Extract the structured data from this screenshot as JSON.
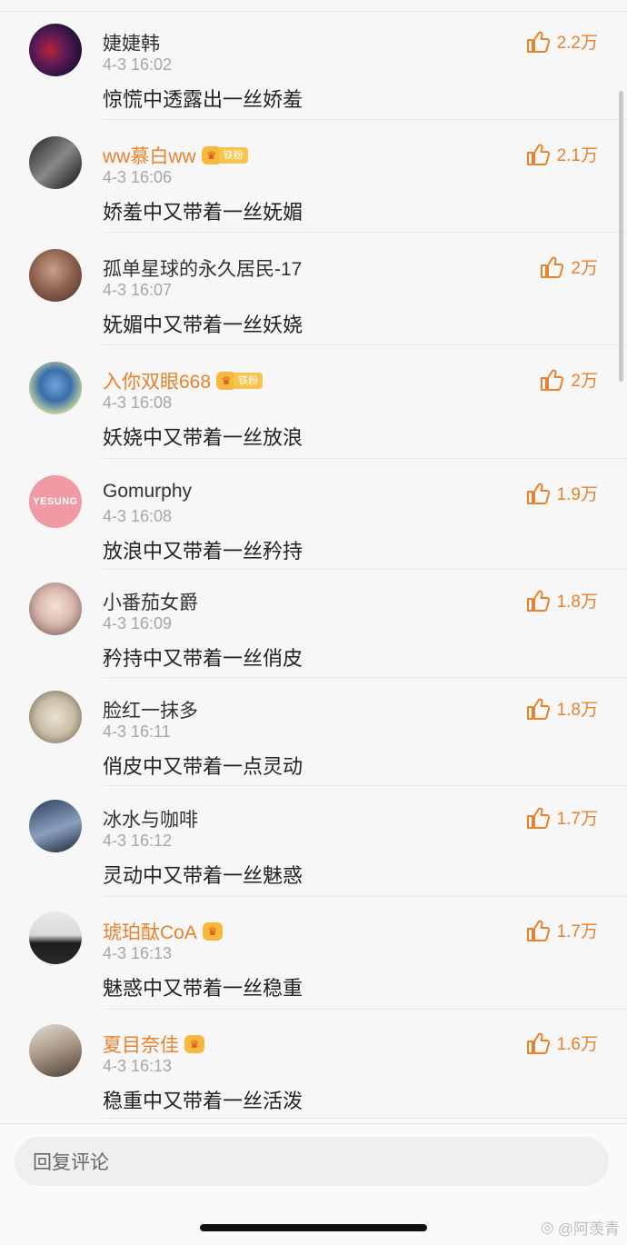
{
  "comments": [
    {
      "name": "婕婕韩",
      "vip": false,
      "badge": "",
      "fan_label": "",
      "time": "4-3 16:02",
      "text": "惊慌中透露出一丝娇羞",
      "likes": "2.2万",
      "avatar": "a0"
    },
    {
      "name": "ww慕白ww",
      "vip": true,
      "badge": "crown",
      "fan_label": "铁粉",
      "time": "4-3 16:06",
      "text": "娇羞中又带着一丝妩媚",
      "likes": "2.1万",
      "avatar": "a1"
    },
    {
      "name": "孤单星球的永久居民-17",
      "vip": false,
      "badge": "",
      "fan_label": "",
      "time": "4-3 16:07",
      "text": "妩媚中又带着一丝妖娆",
      "likes": "2万",
      "avatar": "a2"
    },
    {
      "name": "入你双眼668",
      "vip": true,
      "badge": "crown",
      "fan_label": "铁粉",
      "time": "4-3 16:08",
      "text": "妖娆中又带着一丝放浪",
      "likes": "2万",
      "avatar": "a3"
    },
    {
      "name": "Gomurphy",
      "vip": false,
      "badge": "",
      "fan_label": "",
      "time": "4-3 16:08",
      "text": "放浪中又带着一丝矜持",
      "likes": "1.9万",
      "avatar": "a4",
      "avatar_text": "YESUNG"
    },
    {
      "name": "小番茄女爵",
      "vip": false,
      "badge": "",
      "fan_label": "",
      "time": "4-3 16:09",
      "text": "矜持中又带着一丝俏皮",
      "likes": "1.8万",
      "avatar": "a5"
    },
    {
      "name": "脸红一抹多",
      "vip": false,
      "badge": "",
      "fan_label": "",
      "time": "4-3 16:11",
      "text": "俏皮中又带着一点灵动",
      "likes": "1.8万",
      "avatar": "a6"
    },
    {
      "name": "冰水与咖啡",
      "vip": false,
      "badge": "",
      "fan_label": "",
      "time": "4-3 16:12",
      "text": "灵动中又带着一丝魅惑",
      "likes": "1.7万",
      "avatar": "a7"
    },
    {
      "name": "琥珀酞CoA",
      "vip": true,
      "badge": "crown",
      "fan_label": "",
      "time": "4-3 16:13",
      "text": "魅惑中又带着一丝稳重",
      "likes": "1.7万",
      "avatar": "a8"
    },
    {
      "name": "夏目奈佳",
      "vip": true,
      "badge": "crown",
      "fan_label": "",
      "time": "4-3 16:13",
      "text": "稳重中又带着一丝活泼",
      "likes": "1.6万",
      "avatar": "a9"
    }
  ],
  "reply": {
    "placeholder": "回复评论"
  },
  "watermark": "@阿羡青",
  "colors": {
    "accent": "#e8812c",
    "background": "#f7f7f7",
    "time": "#a6a6a6"
  }
}
